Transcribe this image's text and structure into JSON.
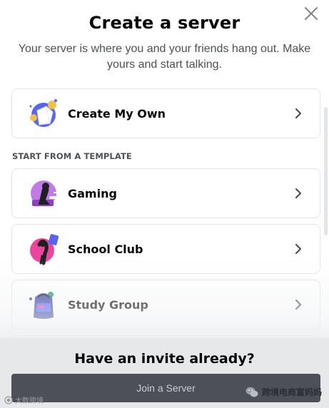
{
  "modal": {
    "title": "Create a server",
    "subtitle": "Your server is where you and your friends hang out. Make yours and start talking.",
    "close_icon": "close-icon"
  },
  "options": {
    "create_own": {
      "label": "Create My Own",
      "icon": "create-own-art-icon"
    },
    "section_label": "START FROM A TEMPLATE",
    "templates": [
      {
        "label": "Gaming",
        "icon": "gaming-art-icon"
      },
      {
        "label": "School Club",
        "icon": "school-club-art-icon"
      },
      {
        "label": "Study Group",
        "icon": "study-group-art-icon"
      }
    ]
  },
  "footer": {
    "title": "Have an invite already?",
    "join_label": "Join a Server"
  },
  "watermarks": {
    "left": "大数跨境",
    "right": "跨境电商富妈妈"
  },
  "colors": {
    "accent_blurple": "#5865f2",
    "button_grey": "#4e5058",
    "text_primary": "#060607"
  }
}
